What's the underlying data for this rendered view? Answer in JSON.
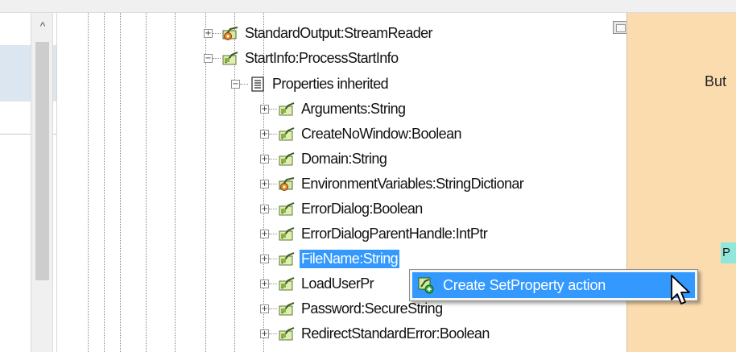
{
  "left_pane": {
    "scroll_arrow": "^"
  },
  "tree": {
    "nodes": [
      {
        "label": "StandardOutput:StreamReader",
        "icon": "property-gear-icon",
        "expander": "+"
      },
      {
        "label": "StartInfo:ProcessStartInfo",
        "icon": "property-icon",
        "expander": "−"
      },
      {
        "label": "Properties inherited",
        "icon": "document-list-icon",
        "expander": "−"
      },
      {
        "label": "Arguments:String",
        "icon": "property-icon",
        "expander": "+"
      },
      {
        "label": "CreateNoWindow:Boolean",
        "icon": "property-icon",
        "expander": "+"
      },
      {
        "label": "Domain:String",
        "icon": "property-icon",
        "expander": "+"
      },
      {
        "label": "EnvironmentVariables:StringDictionar",
        "icon": "property-gear-icon",
        "expander": "+"
      },
      {
        "label": "ErrorDialog:Boolean",
        "icon": "property-icon",
        "expander": "+"
      },
      {
        "label": "ErrorDialogParentHandle:IntPtr",
        "icon": "property-icon",
        "expander": "+"
      },
      {
        "label": "FileName:String",
        "icon": "property-icon",
        "expander": "+",
        "selected": true
      },
      {
        "label": "LoadUserPr",
        "icon": "property-icon",
        "expander": "+"
      },
      {
        "label": "Password:SecureString",
        "icon": "property-icon",
        "expander": "+"
      },
      {
        "label": "RedirectStandardError:Boolean",
        "icon": "property-icon",
        "expander": "+"
      }
    ]
  },
  "right_pane": {
    "but_label": "But",
    "chip_label": "P"
  },
  "context_menu": {
    "item_label": "Create SetProperty action",
    "item_icon": "action-icon"
  },
  "colors": {
    "selection": "#3399ff",
    "right_pane_bg": "#fbdcaf",
    "chip_bg": "#8fe7dc"
  }
}
